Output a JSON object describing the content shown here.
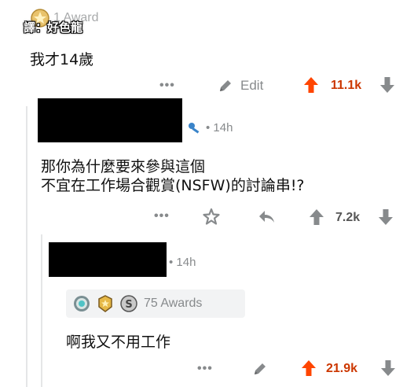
{
  "top_comment": {
    "award_label": "1 Award",
    "translator_credit": "譯：好色龍",
    "body": "我才14歲",
    "actions": {
      "edit_label": "Edit",
      "score": "11.1k"
    }
  },
  "reply_1": {
    "timestamp": "14h",
    "body_line1": "那你為什麼要來參與這個",
    "body_line2": "不宜在工作場合觀賞(NSFW)的討論串!?",
    "actions": {
      "score": "7.2k"
    }
  },
  "reply_2": {
    "timestamp": "14h",
    "awards_label": "75 Awards",
    "body": "啊我又不用工作",
    "actions": {
      "score": "21.9k"
    }
  },
  "icons": {
    "more": "more-dots-icon",
    "edit": "pencil-icon",
    "upvote": "upvote-arrow-icon",
    "downvote": "downvote-arrow-icon",
    "share": "share-arrow-icon",
    "award": "award-gift-icon"
  },
  "colors": {
    "upvoted": "#ff4500",
    "muted": "#878a8c"
  }
}
